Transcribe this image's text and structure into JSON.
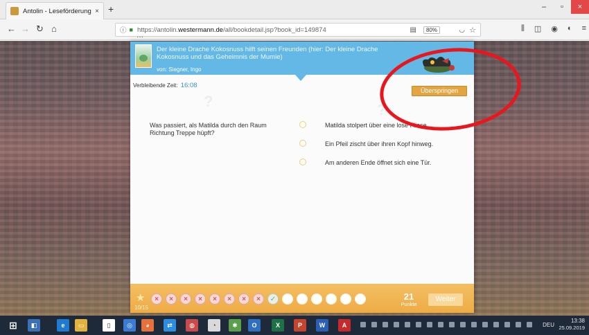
{
  "browser": {
    "tab_title": "Antolin - Leseförderung von ll",
    "tab_close": "×",
    "new_tab": "+",
    "url_prefix": "https://antolin.",
    "url_domain": "westermann.de",
    "url_path": "/all/bookdetail.jsp?book_id=149874",
    "zoom": "80%",
    "window_min": "–",
    "window_max": "▫",
    "window_close": "×"
  },
  "quiz": {
    "book_title": "Der kleine Drache Kokosnuss hilft seinen Freunden (hier: Der kleine Drache Kokosnuss und das Geheimnis der Mumie)",
    "author": "von: Siegner, Ingo",
    "timer_label": "Verbleibende Zeit:",
    "timer_value": "16:08",
    "skip_label": "Überspringen",
    "question": "Was passiert, als Matilda durch den Raum Richtung Treppe hüpft?",
    "answers": [
      "Matilda stolpert über eine lose Fliese.",
      "Ein Pfeil zischt über ihren Kopf hinweg.",
      "Am anderen Ende öffnet sich eine Tür."
    ],
    "progress": {
      "counter": "10/15",
      "results": [
        "wrong",
        "wrong",
        "wrong",
        "wrong",
        "wrong",
        "wrong",
        "wrong",
        "wrong",
        "right",
        "empty",
        "empty",
        "empty",
        "empty",
        "empty",
        "empty"
      ],
      "points_value": "21",
      "points_label": "Punkte"
    },
    "next_label": "Weiter"
  },
  "taskbar": {
    "language": "DEU",
    "time": "13:38",
    "date": "25.09.2019"
  },
  "colors": {
    "header_blue": "#64b8e6",
    "accent_orange": "#e1a542",
    "footer_orange": "#eeac45",
    "annotation_red": "#e8171d"
  }
}
